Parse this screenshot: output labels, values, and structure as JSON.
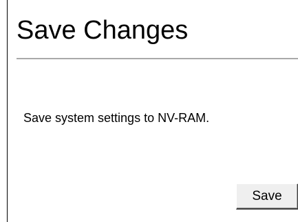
{
  "page": {
    "title": "Save Changes",
    "description": "Save system settings to NV-RAM."
  },
  "actions": {
    "save_label": "Save"
  }
}
